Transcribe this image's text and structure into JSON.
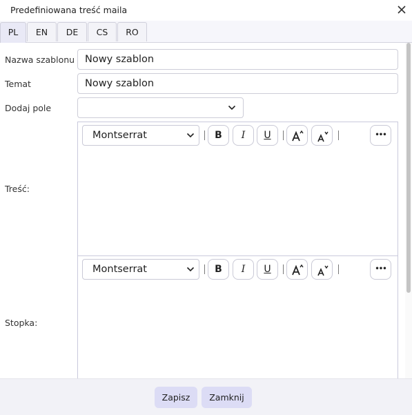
{
  "dialog": {
    "title": "Predefiniowana treść maila"
  },
  "tabs": [
    {
      "label": "PL",
      "active": true
    },
    {
      "label": "EN"
    },
    {
      "label": "DE"
    },
    {
      "label": "CS"
    },
    {
      "label": "RO"
    }
  ],
  "form": {
    "template_name": {
      "label": "Nazwa szablonu",
      "value": "Nowy szablon"
    },
    "subject": {
      "label": "Temat",
      "value": "Nowy szablon"
    },
    "add_field": {
      "label": "Dodaj pole",
      "value": ""
    },
    "body": {
      "label": "Treść:"
    },
    "footer": {
      "label": "Stopka:"
    }
  },
  "editor_toolbar": {
    "font": "Montserrat",
    "bold": "B",
    "italic": "I",
    "underline": "U",
    "more": "•••"
  },
  "actions": {
    "save": "Zapisz",
    "close": "Zamknij"
  },
  "colors": {
    "accent_button": "#dcdcf5",
    "active_tab": "#e9e9f6"
  }
}
